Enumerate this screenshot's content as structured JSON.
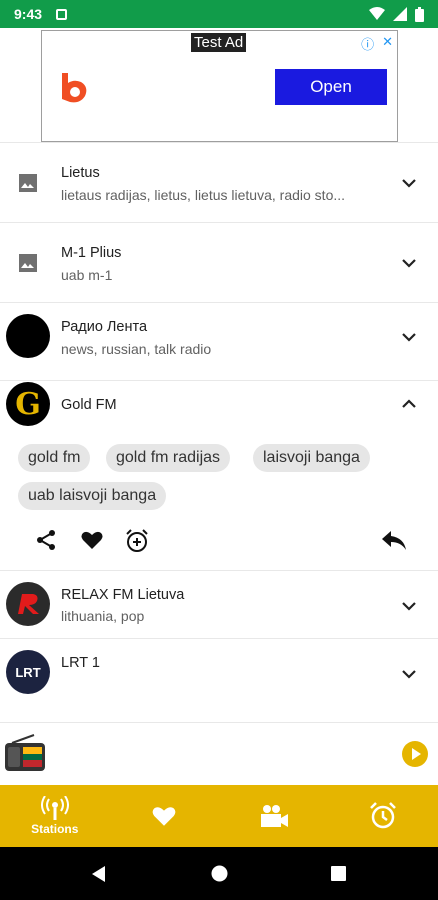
{
  "status_bar": {
    "time": "9:43"
  },
  "ad": {
    "label": "Test Ad",
    "button": "Open"
  },
  "stations": [
    {
      "name": "Lietus",
      "tags": "lietaus radijas, lietus, lietus lietuva, radio sto..."
    },
    {
      "name": "M-1 Plius",
      "tags": "uab m-1"
    },
    {
      "name": "Радио Лента",
      "tags": "news, russian, talk radio"
    },
    {
      "name": "Gold FM",
      "tags": ""
    },
    {
      "name": "RELAX FM Lietuva",
      "tags": "lithuania, pop"
    },
    {
      "name": "LRT 1",
      "tags": ""
    }
  ],
  "expanded_tags": [
    "gold fm",
    "gold fm radijas",
    "laisvoji banga",
    "uab laisvoji banga"
  ],
  "logos": {
    "gold": "G",
    "lrt": "LRT"
  },
  "bottom_nav": [
    {
      "label": "Stations",
      "icon": "radio-tower-icon",
      "active": true
    },
    {
      "label": "",
      "icon": "heart-icon",
      "active": false
    },
    {
      "label": "",
      "icon": "video-camera-icon",
      "active": false
    },
    {
      "label": "",
      "icon": "alarm-clock-icon",
      "active": false
    }
  ],
  "colors": {
    "status_bar": "#119c4a",
    "accent": "#e5b500",
    "ad_button": "#1a1ae0"
  }
}
